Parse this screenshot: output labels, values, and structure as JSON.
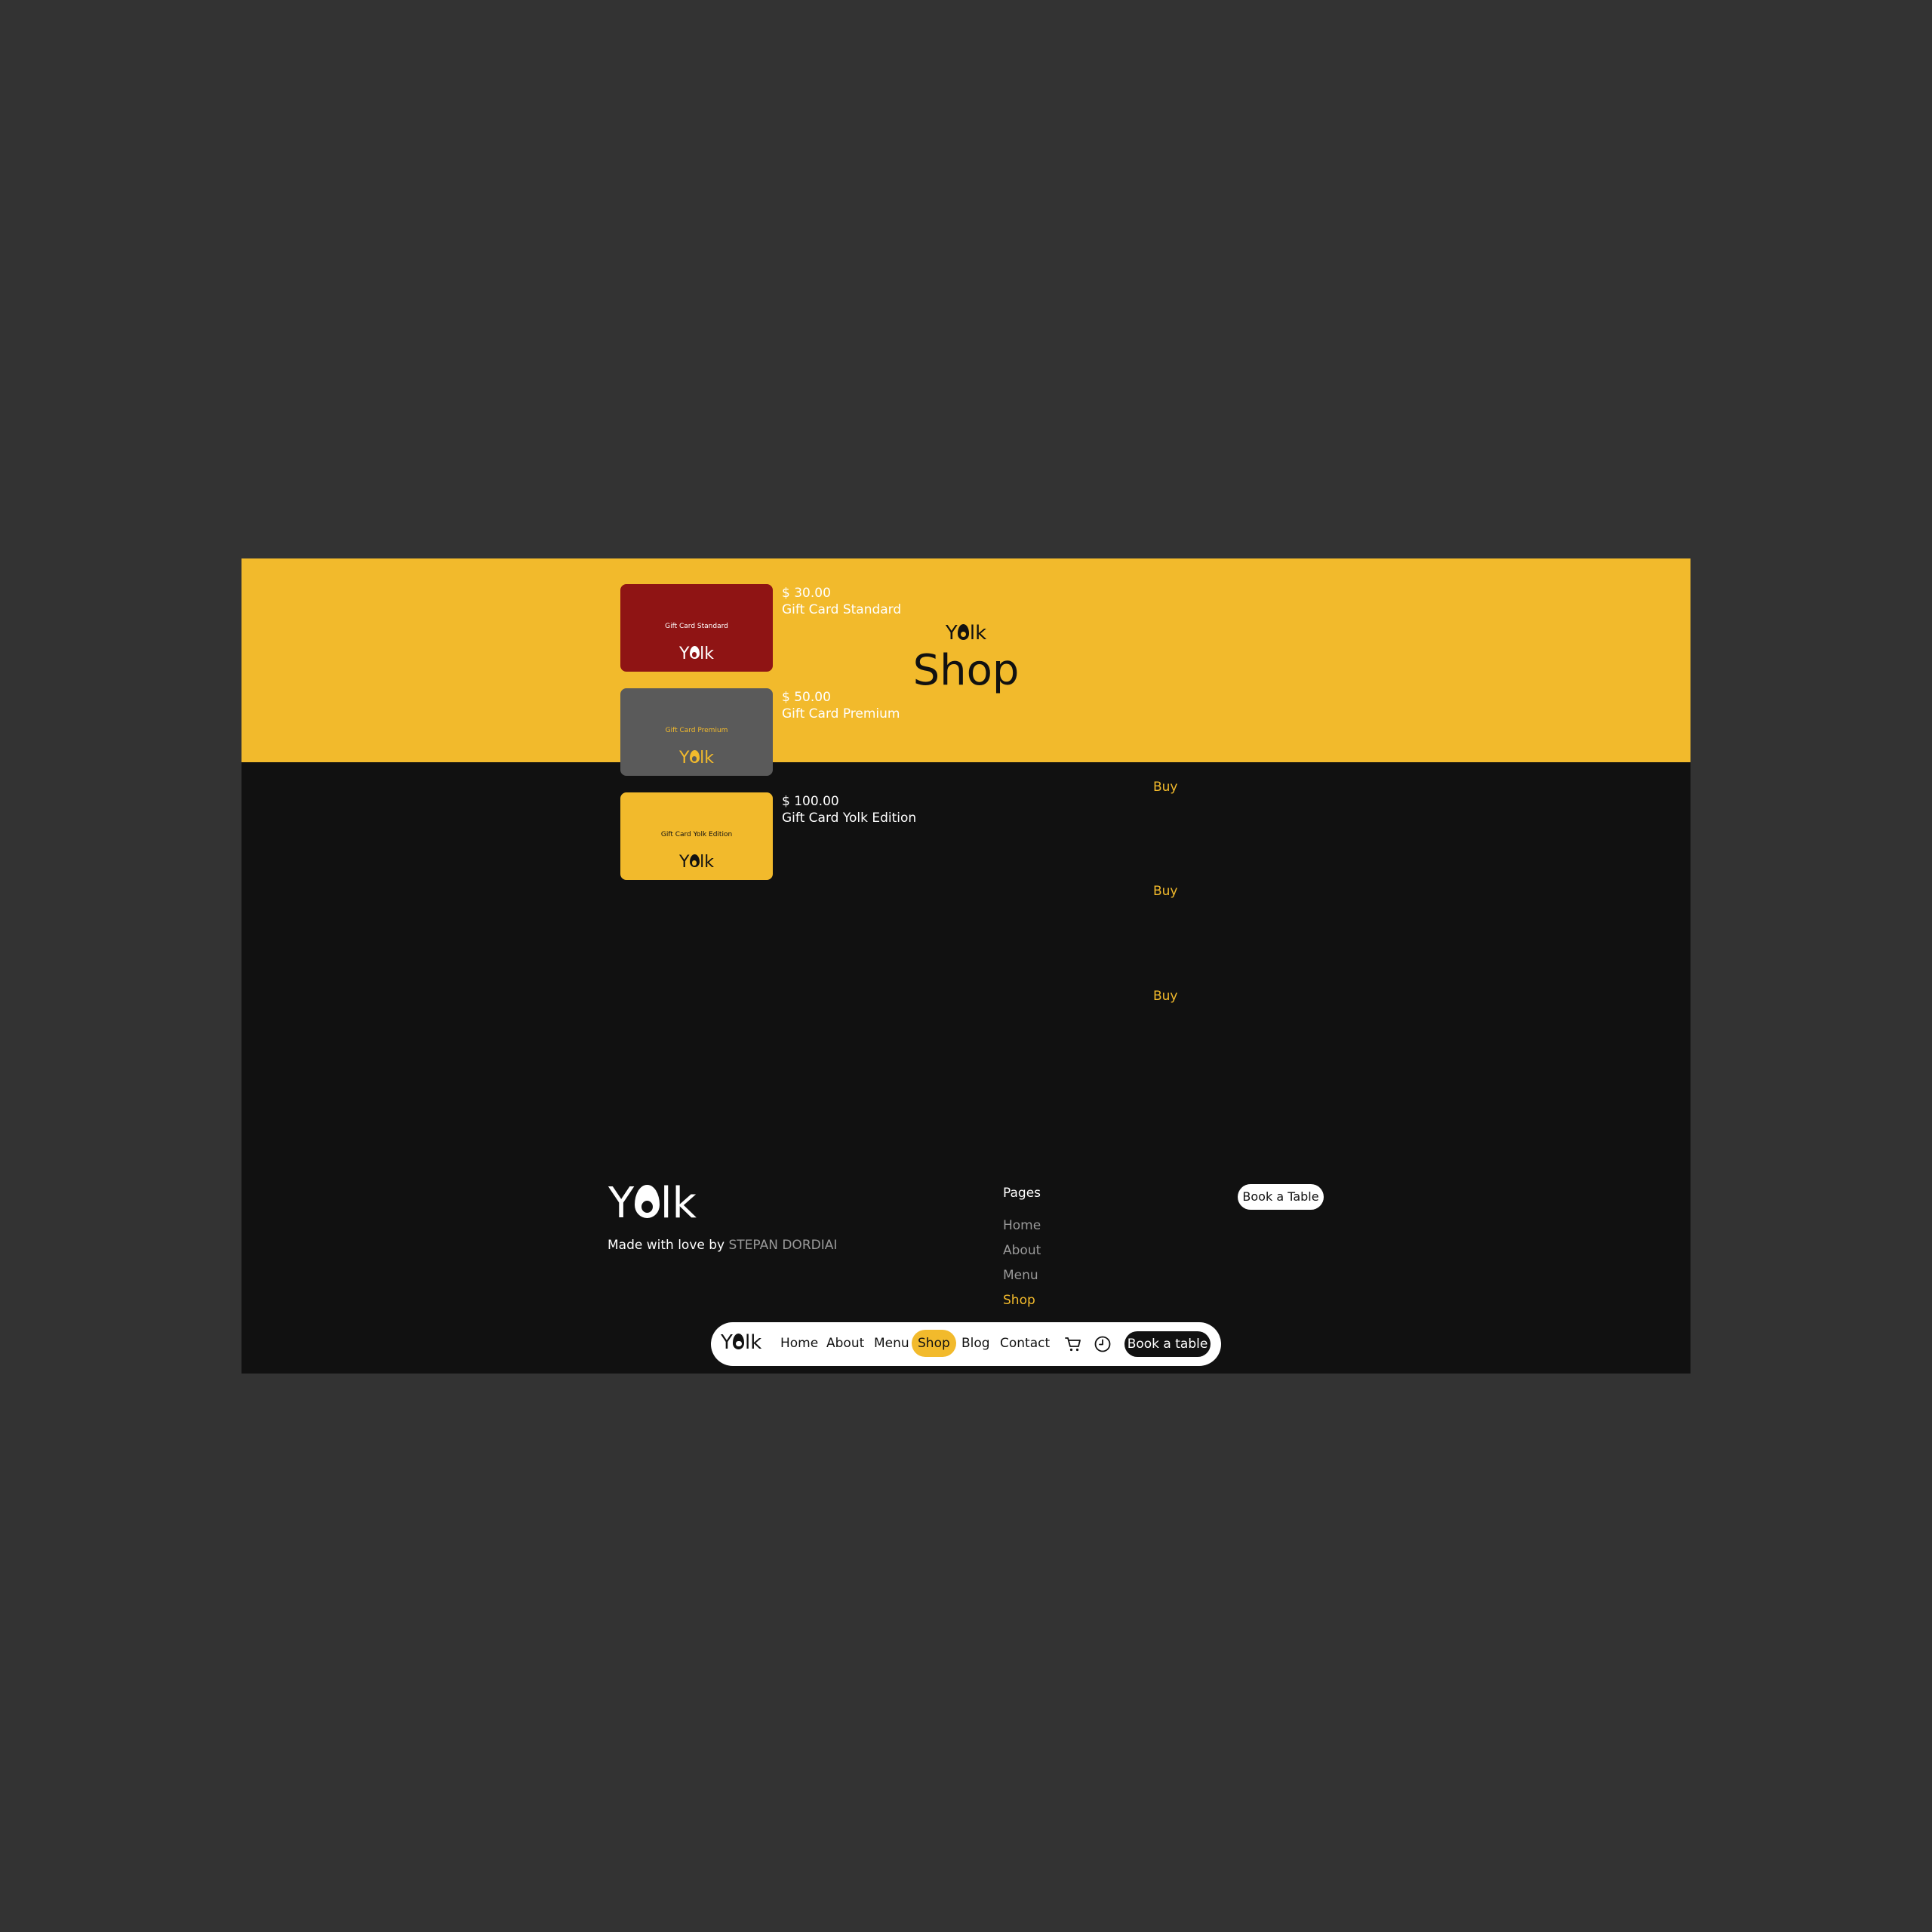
{
  "hero": {
    "logo": "Yolk",
    "title": "Shop"
  },
  "products": [
    {
      "price": "$ 30.00",
      "name": "Gift Card Standard",
      "buy": "Buy",
      "card_text": "Gift Card Standard",
      "card_logo": "Yolk",
      "card_bg": "#8f1414",
      "card_fg": "#ffffff"
    },
    {
      "price": "$ 50.00",
      "name": "Gift Card Premium",
      "buy": "Buy",
      "card_text": "Gift Card Premium",
      "card_logo": "Yolk",
      "card_bg": "#5a5a5a",
      "card_fg": "#f2ba2c"
    },
    {
      "price": "$ 100.00",
      "name": "Gift Card Yolk Edition",
      "buy": "Buy",
      "card_text": "Gift Card Yolk Edition",
      "card_logo": "Yolk",
      "card_bg": "#f2ba2c",
      "card_fg": "#111111"
    }
  ],
  "footer": {
    "logo": "Yolk",
    "made_with": "Made with love by",
    "author": "STEPAN DORDIAI",
    "pages_heading": "Pages",
    "pages": [
      "Home",
      "About",
      "Menu",
      "Shop"
    ],
    "active_page": "Shop",
    "book_button": "Book a Table"
  },
  "navbar": {
    "logo": "Yolk",
    "links": [
      "Home",
      "About",
      "Menu",
      "Shop",
      "Blog",
      "Contact"
    ],
    "active": "Shop",
    "icons": [
      "cart-icon",
      "clock-icon"
    ],
    "book_button": "Book a table"
  },
  "colors": {
    "accent": "#f2ba2c",
    "page_bg": "#111111",
    "outer_bg": "#333333",
    "muted": "#9a9a9a"
  }
}
